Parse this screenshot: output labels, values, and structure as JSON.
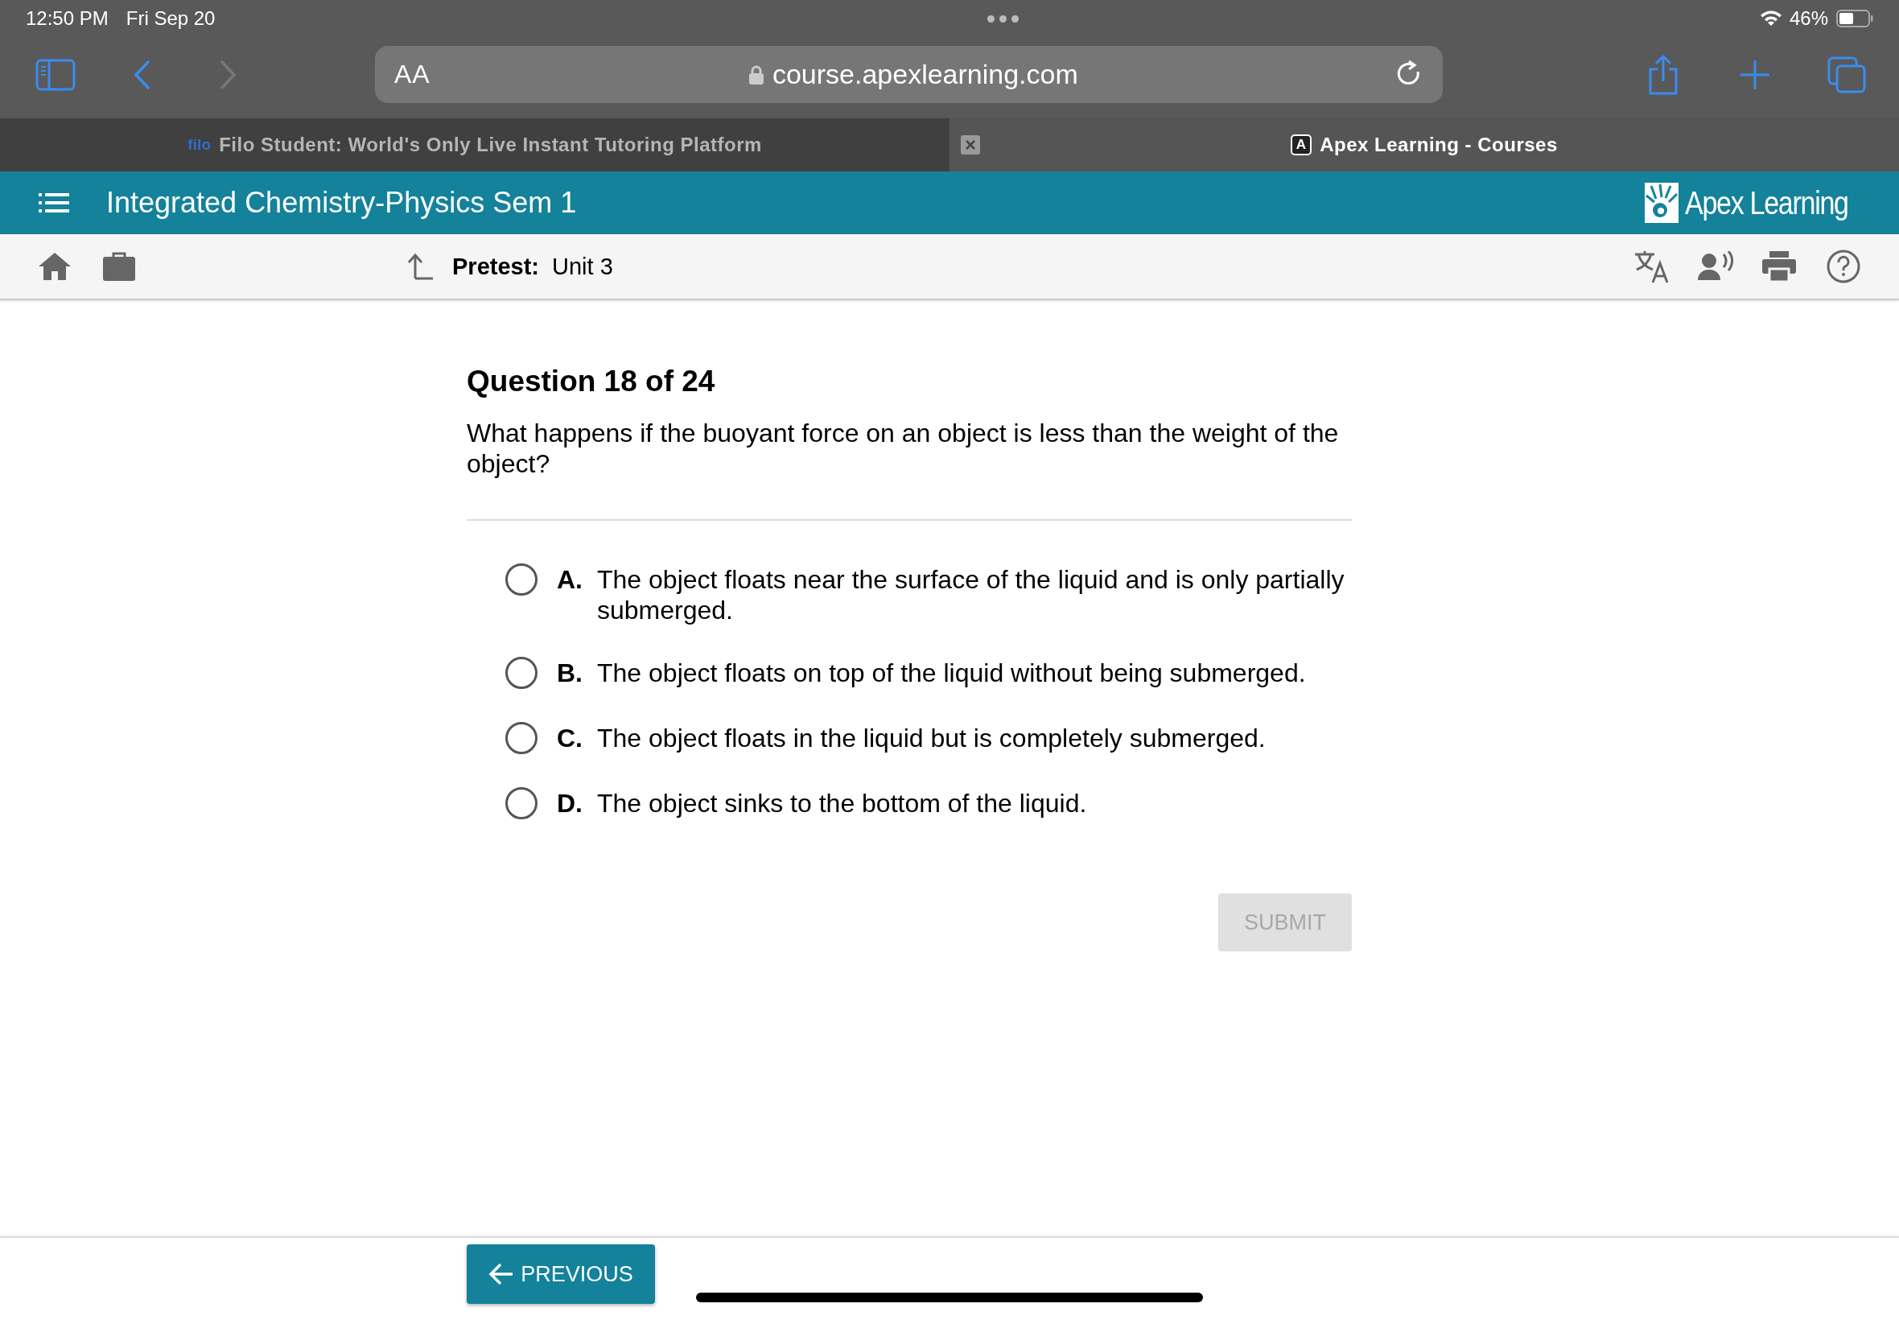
{
  "status_bar": {
    "time": "12:50 PM",
    "date": "Fri Sep 20",
    "battery": "46%"
  },
  "browser": {
    "text_size": "AA",
    "url": "course.apexlearning.com"
  },
  "tabs": [
    {
      "favicon": "filo",
      "title": "Filo Student: World's Only Live Instant Tutoring Platform",
      "selected": false
    },
    {
      "favicon": "A",
      "title": "Apex Learning - Courses",
      "selected": true
    }
  ],
  "course_header": {
    "title": "Integrated Chemistry-Physics Sem 1",
    "logo": "Apex Learning"
  },
  "sub_header": {
    "label": "Pretest:",
    "value": "Unit 3"
  },
  "question": {
    "heading": "Question 18 of 24",
    "text": "What happens if the buoyant force on an object is less than the weight of the object?",
    "options": [
      {
        "letter": "A.",
        "text": "The object floats near the surface of the liquid and is only partially submerged.",
        "selected": false
      },
      {
        "letter": "B.",
        "text": "The object floats on top of the liquid without being submerged.",
        "selected": false
      },
      {
        "letter": "C.",
        "text": "The object floats in the liquid but is completely submerged.",
        "selected": false
      },
      {
        "letter": "D.",
        "text": "The object sinks to the bottom of the liquid.",
        "selected": false
      }
    ],
    "submit": {
      "label": "SUBMIT",
      "disabled": true
    }
  },
  "footer": {
    "previous": "PREVIOUS"
  }
}
